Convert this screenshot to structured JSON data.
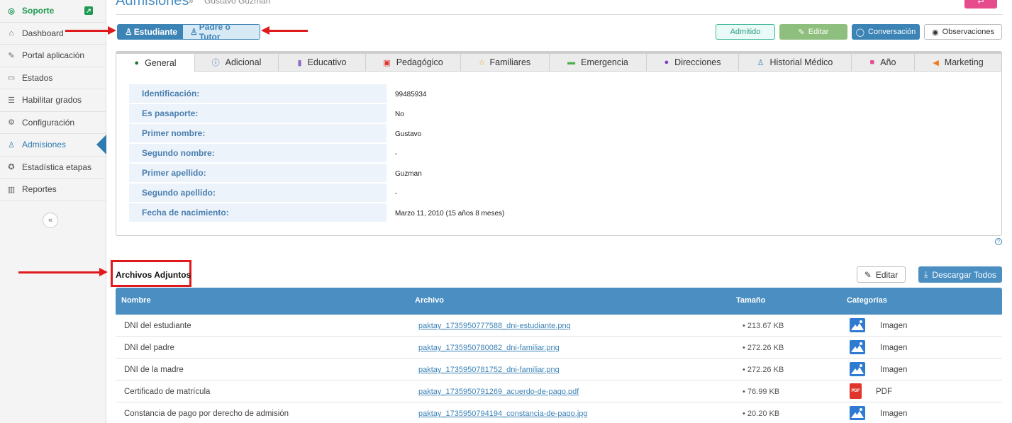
{
  "sidebar": {
    "items": [
      {
        "label": "Soporte",
        "icon": "lifebuoy-icon"
      },
      {
        "label": "Dashboard",
        "icon": "home-icon"
      },
      {
        "label": "Portal aplicación",
        "icon": "edit-icon"
      },
      {
        "label": "Estados",
        "icon": "folder-icon"
      },
      {
        "label": "Habilitar grados",
        "icon": "list-icon"
      },
      {
        "label": "Configuración",
        "icon": "gear-icon"
      },
      {
        "label": "Admisiones",
        "icon": "user-icon"
      },
      {
        "label": "Estadística etapas",
        "icon": "medal-icon"
      },
      {
        "label": "Reportes",
        "icon": "bar-chart-icon"
      }
    ],
    "collapse_glyph": "«"
  },
  "header": {
    "title": "Admisiones",
    "separator": "»",
    "crumb": "Gustavo Guzman"
  },
  "toggle": {
    "student": "Estudiante",
    "parent": "Padre o Tutor"
  },
  "actions": {
    "admitido": "Admitido",
    "editar": "Editar",
    "conversacion": "Conversación",
    "observaciones": "Observaciones"
  },
  "tabs": [
    {
      "label": "General",
      "icon": "person-icon",
      "color": "#1e7a3c"
    },
    {
      "label": "Adicional",
      "icon": "info-icon",
      "color": "#3c6fb0"
    },
    {
      "label": "Educativo",
      "icon": "book-icon",
      "color": "#8a6bbf"
    },
    {
      "label": "Pedagógico",
      "icon": "teacher-icon",
      "color": "#e0352b"
    },
    {
      "label": "Familiares",
      "icon": "house-icon",
      "color": "#f0a020"
    },
    {
      "label": "Emergencia",
      "icon": "ambulance-icon",
      "color": "#4caf50"
    },
    {
      "label": "Direcciones",
      "icon": "map-pin-icon",
      "color": "#7b3fc4"
    },
    {
      "label": "Historial Médico",
      "icon": "medical-user-icon",
      "color": "#3c83b6"
    },
    {
      "label": "Año",
      "icon": "calendar-icon",
      "color": "#e64b8b"
    },
    {
      "label": "Marketing",
      "icon": "megaphone-icon",
      "color": "#f07a1a"
    }
  ],
  "general": [
    {
      "label": "Identificación:",
      "value": "99485934"
    },
    {
      "label": "Es pasaporte:",
      "value": "No"
    },
    {
      "label": "Primer nombre:",
      "value": "Gustavo"
    },
    {
      "label": "Segundo nombre:",
      "value": "-"
    },
    {
      "label": "Primer apellido:",
      "value": "Guzman"
    },
    {
      "label": "Segundo apellido:",
      "value": "-"
    },
    {
      "label": "Fecha de nacimiento:",
      "value": "Marzo 11, 2010 (15 años 8 meses)"
    }
  ],
  "attachments": {
    "title": "Archivos Adjuntos",
    "edit": "Editar",
    "download_all": "Descargar Todos",
    "columns": [
      "Nombre",
      "Archivo",
      "Tamaño",
      "Categorías"
    ],
    "rows": [
      {
        "name": "DNI del estudiante",
        "file": "paktay_1735950777588_dni-estudiante.png",
        "size": "• 213.67 KB",
        "category": "Imagen",
        "type": "image"
      },
      {
        "name": "DNI del padre",
        "file": "paktay_1735950780082_dni-familiar.png",
        "size": "• 272.26 KB",
        "category": "Imagen",
        "type": "image"
      },
      {
        "name": "DNI de la madre",
        "file": "paktay_1735950781752_dni-familiar.png",
        "size": "• 272.26 KB",
        "category": "Imagen",
        "type": "image"
      },
      {
        "name": "Certificado de matrícula",
        "file": "paktay_1735950791269_acuerdo-de-pago.pdf",
        "size": "• 76.99 KB",
        "category": "PDF",
        "type": "pdf"
      },
      {
        "name": "Constancia de pago por derecho de admisión",
        "file": "paktay_1735950794194_constancia-de-pago.jpg",
        "size": "• 20.20 KB",
        "category": "Imagen",
        "type": "image"
      }
    ]
  },
  "colors": {
    "accent": "#3c83b6",
    "annotation": "#e0191c",
    "support": "#1e9a54"
  }
}
